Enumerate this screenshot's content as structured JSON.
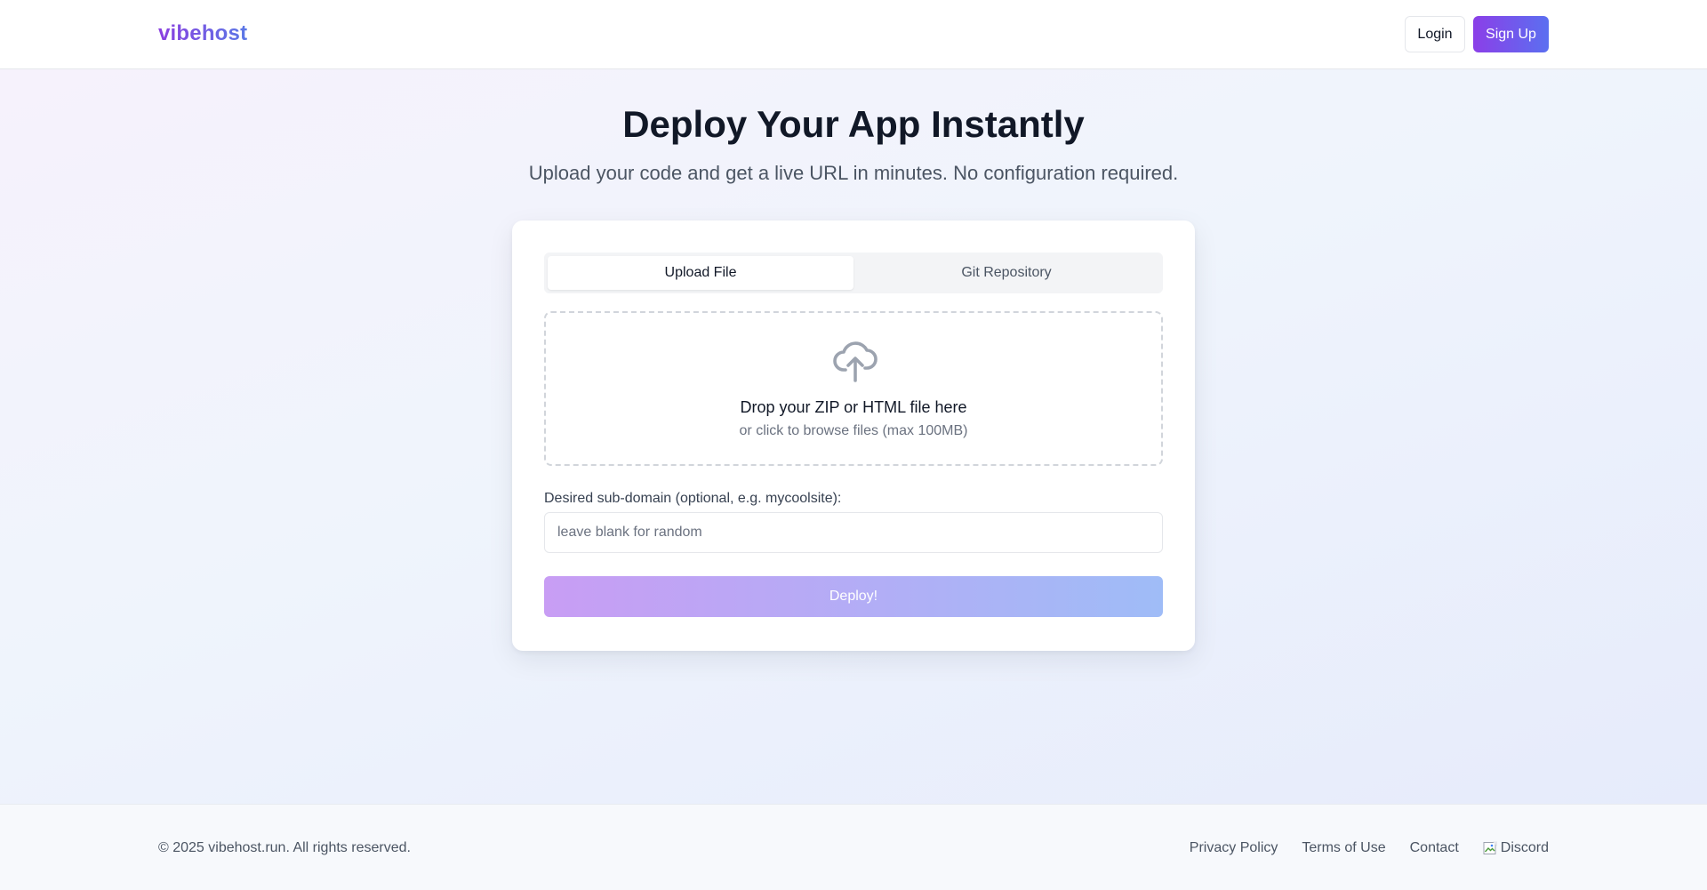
{
  "header": {
    "logo": "vibehost",
    "login_label": "Login",
    "signup_label": "Sign Up"
  },
  "hero": {
    "title": "Deploy Your App Instantly",
    "subtitle": "Upload your code and get a live URL in minutes. No configuration required."
  },
  "tabs": [
    {
      "label": "Upload File",
      "active": true
    },
    {
      "label": "Git Repository",
      "active": false
    }
  ],
  "dropzone": {
    "icon": "cloud-upload-icon",
    "title": "Drop your ZIP or HTML file here",
    "hint": "or click to browse files (max 100MB)"
  },
  "subdomain": {
    "label": "Desired sub-domain (optional, e.g. mycoolsite):",
    "value": "",
    "placeholder": "leave blank for random"
  },
  "deploy": {
    "label": "Deploy!"
  },
  "footer": {
    "copyright": "© 2025 vibehost.run. All rights reserved.",
    "links": [
      "Privacy Policy",
      "Terms of Use",
      "Contact",
      "Discord"
    ],
    "discord_icon": "broken-image-icon"
  },
  "colors": {
    "brand_start": "#8b3fe8",
    "brand_end": "#5b6ff0",
    "deploy_start": "#c89df4",
    "deploy_end": "#9fbcf7"
  }
}
